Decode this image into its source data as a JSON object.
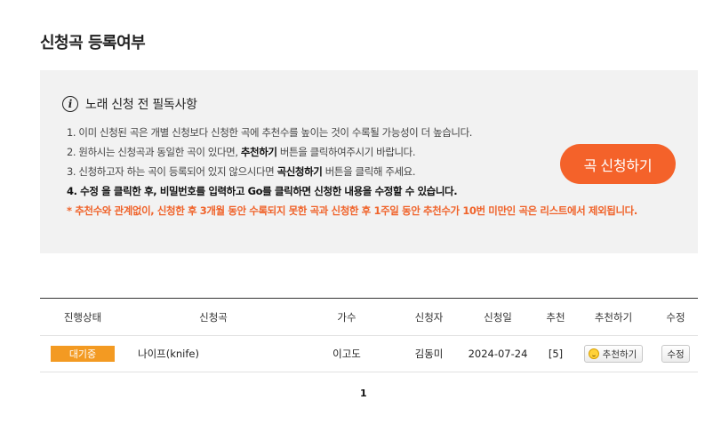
{
  "page": {
    "title": "신청곡 등록여부"
  },
  "notice": {
    "icon": "info-icon",
    "title": "노래 신청 전 필독사항",
    "line1": "1. 이미 신청된 곡은 개별 신청보다 신청한 곡에 추천수를 높이는 것이 수록될 가능성이 더 높습니다.",
    "line2_pre": "2. 원하시는 신청곡과 동일한 곡이 있다면, ",
    "line2_bold": "추천하기",
    "line2_post": " 버튼을 클릭하여주시기 바랍니다.",
    "line3_pre": "3. 신청하고자 하는 곡이 등록되어 있지 않으시다면 ",
    "line3_bold": "곡신청하기",
    "line3_post": " 버튼을 클릭해 주세요.",
    "line4": "4. 수정 을 클릭한 후, 비밀번호를 입력하고 Go를 클릭하면 신청한 내용을 수정할 수 있습니다.",
    "warning": "* 추천수와 관계없이, 신청한 후 3개월 동안 수록되지 못한 곡과 신청한 후 1주일 동안 추천수가 10번 미만인 곡은 리스트에서 제외됩니다.",
    "request_button": "곡 신청하기"
  },
  "table": {
    "headers": {
      "status": "진행상태",
      "song": "신청곡",
      "artist": "가수",
      "requester": "신청자",
      "date": "신청일",
      "recommend": "추천",
      "recommend_action": "추천하기",
      "edit": "수정"
    },
    "rows": [
      {
        "status": "대기중",
        "song": "나이프(knife)",
        "artist": "이고도",
        "requester": "김동미",
        "date": "2024-07-24",
        "recommend": "[5]",
        "recommend_button": "추천하기",
        "edit_button": "수정"
      }
    ]
  },
  "pagination": {
    "current": "1"
  },
  "colors": {
    "accent": "#f4622a",
    "warning": "#f0632a",
    "badge": "#f39a22",
    "notice_bg": "#f2f2f2"
  }
}
